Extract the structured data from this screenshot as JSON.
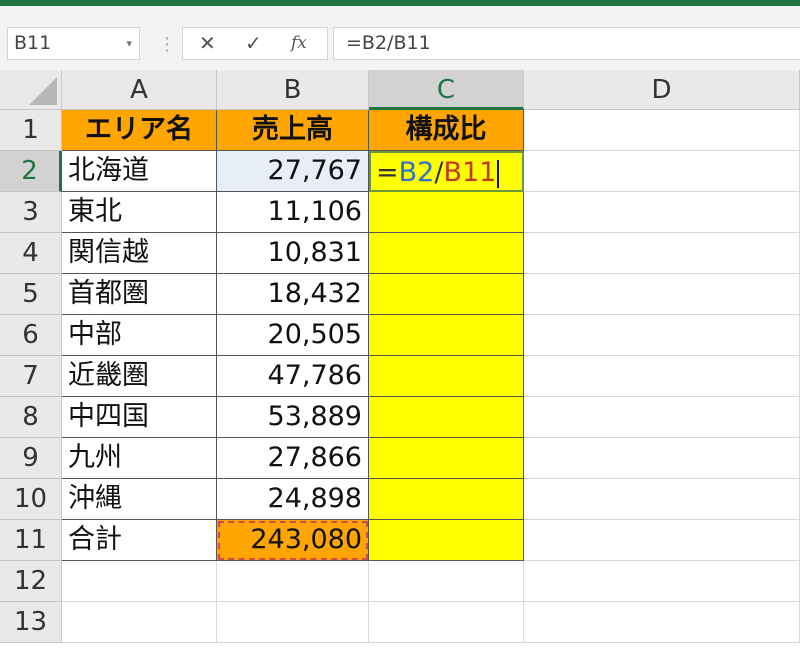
{
  "name_box": {
    "value": "B11",
    "dropdown_glyph": "▾"
  },
  "formula_bar": {
    "cancel_glyph": "✕",
    "enter_glyph": "✓",
    "function_glyph": "fx",
    "formula": "=B2/B11"
  },
  "columns": [
    "A",
    "B",
    "C",
    "D"
  ],
  "rows": [
    "1",
    "2",
    "3",
    "4",
    "5",
    "6",
    "7",
    "8",
    "9",
    "10",
    "11",
    "12",
    "13"
  ],
  "table": {
    "headers": {
      "area": "エリア名",
      "sales": "売上高",
      "ratio": "構成比"
    },
    "data": [
      {
        "area": "北海道",
        "sales": "27,767"
      },
      {
        "area": "東北",
        "sales": "11,106"
      },
      {
        "area": "関信越",
        "sales": "10,831"
      },
      {
        "area": "首都圏",
        "sales": "18,432"
      },
      {
        "area": "中部",
        "sales": "20,505"
      },
      {
        "area": "近畿圏",
        "sales": "47,786"
      },
      {
        "area": "中四国",
        "sales": "53,889"
      },
      {
        "area": "九州",
        "sales": "27,866"
      },
      {
        "area": "沖縄",
        "sales": "24,898"
      }
    ],
    "total": {
      "area": "合計",
      "sales": "243,080"
    }
  },
  "editing_cell": {
    "eq": "=",
    "ref1": "B2",
    "op": "/",
    "ref2": "B11"
  },
  "colors": {
    "excel_green": "#217346",
    "header_fill": "#ffa500",
    "ratio_fill": "#ffff00",
    "ref1_color": "#2f6fd0",
    "ref2_color": "#c0392b"
  }
}
